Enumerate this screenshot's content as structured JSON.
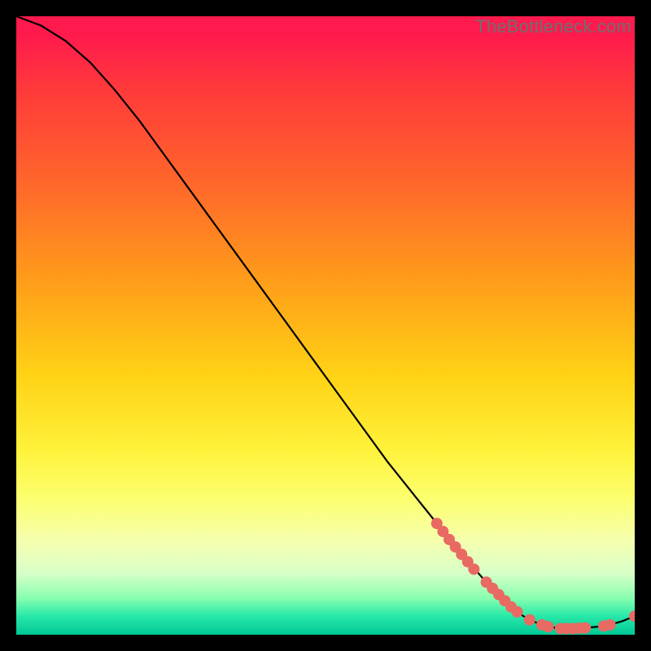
{
  "watermark": "TheBottleneck.com",
  "chart_data": {
    "type": "line",
    "title": "",
    "xlabel": "",
    "ylabel": "",
    "xlim": [
      0,
      100
    ],
    "ylim": [
      0,
      100
    ],
    "grid": false,
    "legend": null,
    "series": [
      {
        "name": "bottleneck-curve",
        "x": [
          0,
          4,
          8,
          12,
          16,
          20,
          24,
          28,
          32,
          36,
          40,
          44,
          48,
          52,
          56,
          60,
          64,
          68,
          72,
          76,
          80,
          82,
          84,
          86,
          88,
          90,
          92,
          94,
          96,
          98,
          100
        ],
        "y": [
          100,
          98.5,
          96,
          92.5,
          88,
          83,
          77.5,
          72,
          66.5,
          61,
          55.5,
          50,
          44.5,
          39,
          33.5,
          28,
          23,
          18,
          13,
          8.5,
          4.5,
          3,
          2,
          1.3,
          1,
          1,
          1.1,
          1.3,
          1.6,
          2.2,
          3
        ]
      }
    ],
    "markers": {
      "name": "highlighted-points",
      "x": [
        68,
        69,
        70,
        71,
        72,
        73,
        74,
        76,
        77,
        78,
        79,
        80,
        81,
        83,
        85,
        86,
        88,
        89,
        90,
        91,
        92,
        95,
        96,
        100
      ],
      "y": [
        18,
        16.7,
        15.4,
        14.2,
        13,
        11.8,
        10.6,
        8.5,
        7.5,
        6.5,
        5.5,
        4.5,
        3.7,
        2.4,
        1.6,
        1.3,
        1.0,
        1.0,
        1.0,
        1.05,
        1.1,
        1.4,
        1.6,
        3.0
      ]
    },
    "background_gradient": {
      "top": "#ff1a4d",
      "mid": "#fff23a",
      "bottom": "#00c896"
    }
  }
}
